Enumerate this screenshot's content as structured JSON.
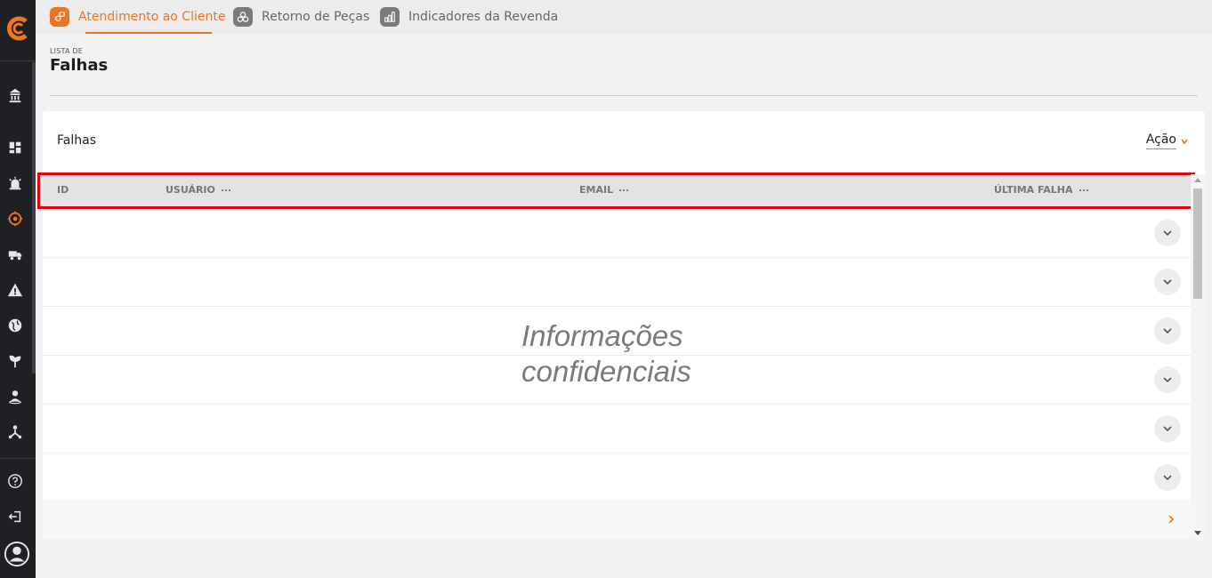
{
  "nav": {
    "tabs": [
      {
        "label": "Atendimento ao Cliente",
        "active": true
      },
      {
        "label": "Retorno de Peças",
        "active": false
      },
      {
        "label": "Indicadores da Revenda",
        "active": false
      }
    ]
  },
  "page": {
    "kicker": "LISTA DE",
    "title": "Falhas"
  },
  "card": {
    "title": "Falhas",
    "action_label": "Ação"
  },
  "table": {
    "columns": [
      "ID",
      "USUÁRIO",
      "EMAIL",
      "ÚLTIMA FALHA"
    ]
  },
  "overlay": {
    "line1": "Informações",
    "line2": "confidenciais"
  },
  "colors": {
    "accent": "#f07426",
    "sidebar": "#1e2024",
    "highlight": "#e8000c"
  }
}
